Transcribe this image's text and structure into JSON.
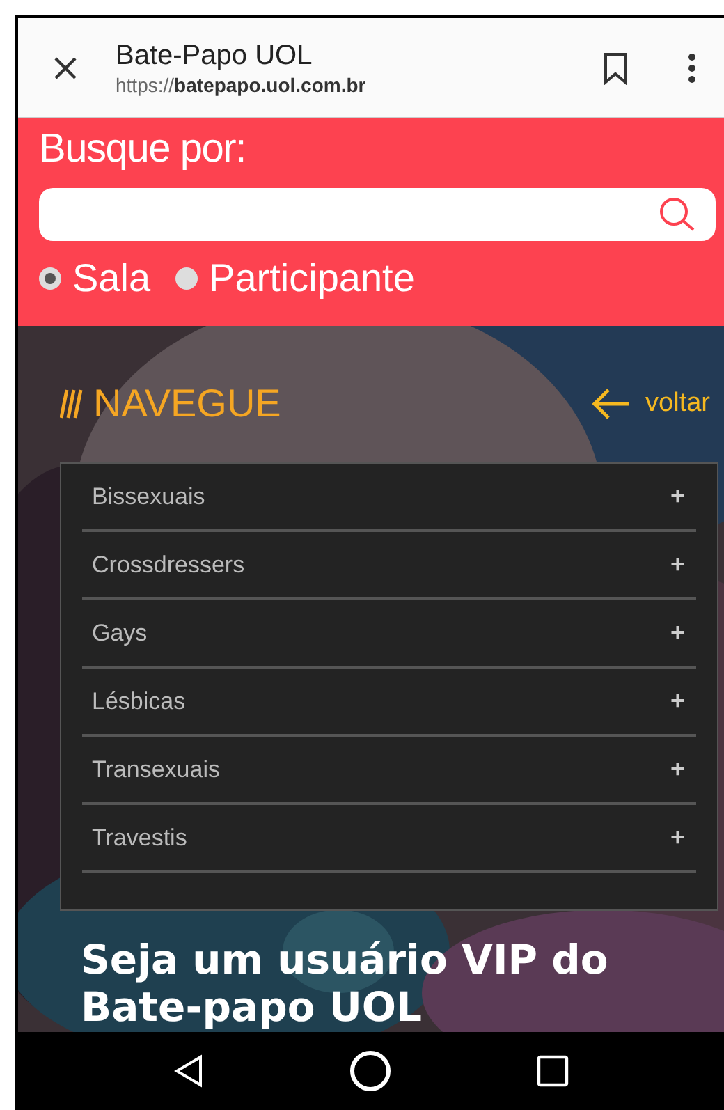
{
  "browser_bar": {
    "title": "Bate-Papo UOL",
    "url_scheme": "https://",
    "url_host": "batepapo.uol.com.br"
  },
  "search": {
    "label": "Busque por:",
    "options": [
      {
        "label": "Sala",
        "selected": true
      },
      {
        "label": "Participante",
        "selected": false
      }
    ]
  },
  "navigation": {
    "title": "NAVEGUE",
    "back_link": "voltar",
    "items": [
      {
        "label": "Bissexuais",
        "expand": "+"
      },
      {
        "label": "Crossdressers",
        "expand": "+"
      },
      {
        "label": "Gays",
        "expand": "+"
      },
      {
        "label": "Lésbicas",
        "expand": "+"
      },
      {
        "label": "Transexuais",
        "expand": "+"
      },
      {
        "label": "Travestis",
        "expand": "+"
      }
    ]
  },
  "promo": {
    "heading": "Seja um usuário VIP do Bate-papo UOL"
  }
}
